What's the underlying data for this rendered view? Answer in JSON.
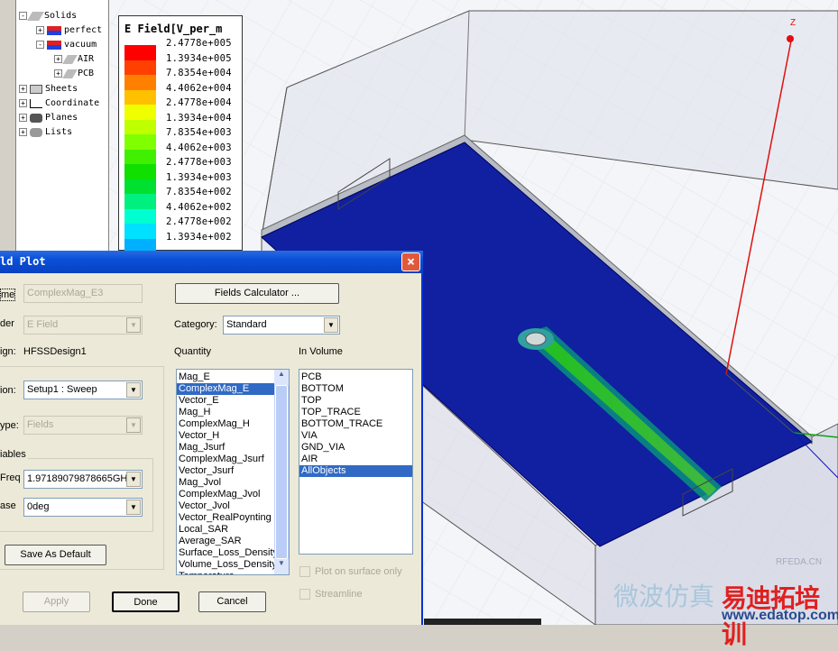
{
  "tree": {
    "items": [
      {
        "label": "Solids",
        "expander": "-"
      },
      {
        "label": "perfect",
        "expander": "+"
      },
      {
        "label": "vacuum",
        "expander": "-"
      },
      {
        "label": "AIR",
        "expander": "+"
      },
      {
        "label": "PCB",
        "expander": "+"
      },
      {
        "label": "Sheets",
        "expander": "+"
      },
      {
        "label": "Coordinate",
        "expander": "+"
      },
      {
        "label": "Planes",
        "expander": "+"
      },
      {
        "label": "Lists",
        "expander": "+"
      }
    ]
  },
  "legend": {
    "title": "E Field[V_per_m",
    "values": [
      "2.4778e+005",
      "1.3934e+005",
      "7.8354e+004",
      "4.4062e+004",
      "2.4778e+004",
      "1.3934e+004",
      "7.8354e+003",
      "4.4062e+003",
      "2.4778e+003",
      "1.3934e+003",
      "7.8354e+002",
      "4.4062e+002",
      "2.4778e+002",
      "1.3934e+002"
    ],
    "colors": [
      "#ff0000",
      "#ff4000",
      "#ff8000",
      "#ffc000",
      "#f0ff00",
      "#c0ff00",
      "#80ff00",
      "#40f000",
      "#10e000",
      "#00e030",
      "#00f080",
      "#00ffd0",
      "#00e0ff",
      "#00b0ff",
      "#0070ff"
    ]
  },
  "scene": {
    "axis_label": "Z"
  },
  "dialog": {
    "title": "ld Plot",
    "close": "×",
    "name_label": "me",
    "name_value": "ComplexMag_E3",
    "folder_label": "der",
    "folder_value": "E Field",
    "design_label": "ign:",
    "design_value": "HFSSDesign1",
    "solution_label": "ion:",
    "solution_value": "Setup1 : Sweep",
    "type_label": "ype:",
    "type_value": "Fields",
    "variables_label": "iables",
    "freq_label": "Freq",
    "freq_value": "1.97189079878665GH:",
    "phase_label": "ase",
    "phase_value": "0deg",
    "save_default": "Save As Default",
    "fields_calculator": "Fields Calculator ...",
    "category_label": "Category:",
    "category_value": "Standard",
    "quantity_label": "Quantity",
    "quantity_items": [
      "Mag_E",
      "ComplexMag_E",
      "Vector_E",
      "Mag_H",
      "ComplexMag_H",
      "Vector_H",
      "Mag_Jsurf",
      "ComplexMag_Jsurf",
      "Vector_Jsurf",
      "Mag_Jvol",
      "ComplexMag_Jvol",
      "Vector_Jvol",
      "Vector_RealPoynting",
      "Local_SAR",
      "Average_SAR",
      "Surface_Loss_Density",
      "Volume_Loss_Density",
      "Temperature"
    ],
    "quantity_selected": "ComplexMag_E",
    "volume_label": "In Volume",
    "volume_items": [
      "PCB",
      "BOTTOM",
      "TOP",
      "TOP_TRACE",
      "BOTTOM_TRACE",
      "VIA",
      "GND_VIA",
      "AIR",
      "AllObjects"
    ],
    "volume_selected": "AllObjects",
    "plot_on_surface": "Plot on surface only",
    "streamline": "Streamline",
    "apply": "Apply",
    "done": "Done",
    "cancel": "Cancel"
  },
  "watermark": {
    "line1": "微波仿真",
    "brand": "易迪拓培训",
    "url": "www.edatop.com",
    "site": "RFEDA.CN"
  }
}
